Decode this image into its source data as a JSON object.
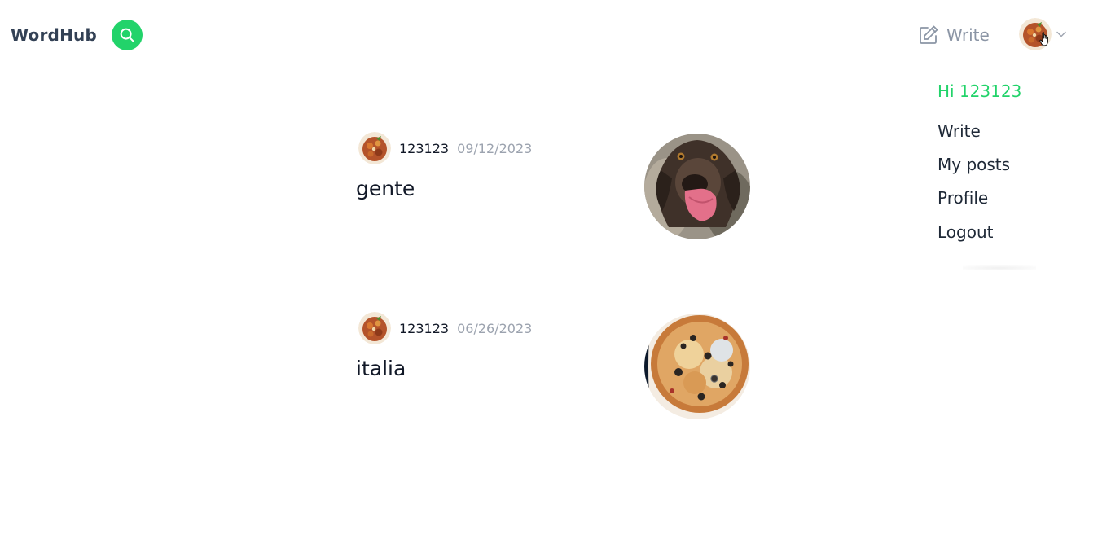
{
  "app": {
    "name": "WordHub"
  },
  "header": {
    "search_icon": "search-icon",
    "write_label": "Write",
    "write_icon": "edit-icon",
    "chevron_icon": "chevron-down-icon"
  },
  "dropdown": {
    "greeting": "Hi 123123",
    "items": [
      {
        "label": "Write"
      },
      {
        "label": "My posts"
      },
      {
        "label": "Profile"
      },
      {
        "label": "Logout"
      }
    ]
  },
  "posts": [
    {
      "author": "123123",
      "date": "09/12/2023",
      "title": "gente",
      "thumbnail": "dog-photo"
    },
    {
      "author": "123123",
      "date": "06/26/2023",
      "title": "italia",
      "thumbnail": "pizza-photo"
    }
  ],
  "colors": {
    "accent": "#22d36a",
    "logo": "#334155",
    "muted": "#8b95a5",
    "text": "#111827"
  }
}
